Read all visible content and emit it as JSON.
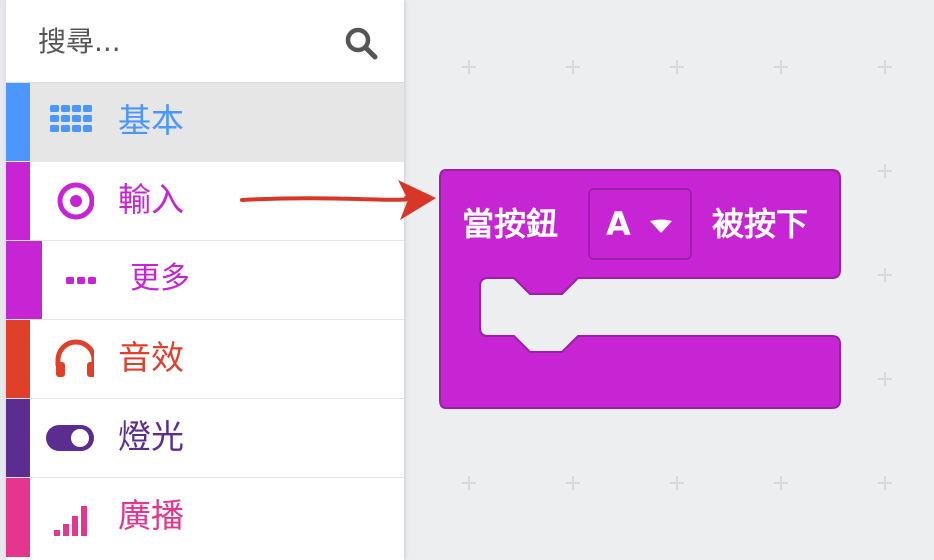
{
  "search": {
    "placeholder": "搜尋..."
  },
  "categories": [
    {
      "label": "基本",
      "color": "#4c97ff",
      "icon": "grid-icon",
      "selected": true
    },
    {
      "label": "輸入",
      "color": "#c724d3",
      "icon": "target-icon"
    },
    {
      "label": "更多",
      "color": "#c724d3",
      "icon": "more-dots-icon",
      "sub": true
    },
    {
      "label": "音效",
      "color": "#e0402a",
      "icon": "headphones-icon"
    },
    {
      "label": "燈光",
      "color": "#5c2d91",
      "icon": "toggle-icon"
    },
    {
      "label": "廣播",
      "color": "#e3368c",
      "icon": "signal-bars-icon"
    }
  ],
  "block": {
    "prefix": "當按鈕",
    "button_value": "A",
    "suffix": "被按下",
    "color": "#c724d3",
    "border_color": "#9c1fa8"
  },
  "colors": {
    "canvas_bg": "#edeef0",
    "selected_row_bg": "#e6e6e6",
    "arrow": "#d9362a"
  }
}
